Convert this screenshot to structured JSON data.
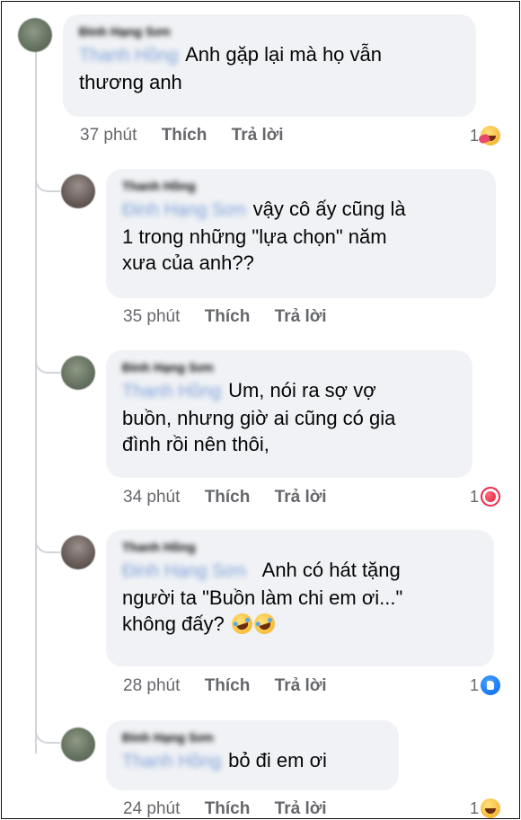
{
  "comments": [
    {
      "author": "Đinh Hạng Sơn",
      "mention": "Thanh Hồng",
      "text_lines": [
        "Anh gặp lại mà họ vẫn",
        "thương anh"
      ],
      "time": "37 phút",
      "like_label": "Thích",
      "reply_label": "Trả lời",
      "reaction_count": "1",
      "reaction_icon": "care-icon"
    },
    {
      "author": "Thanh Hồng",
      "mention": "Đinh Hạng Sơn",
      "text_lines": [
        "vậy cô ấy cũng là",
        "1 trong những \"lựa chọn\" năm",
        "xưa của anh??"
      ],
      "time": "35 phút",
      "like_label": "Thích",
      "reply_label": "Trả lời"
    },
    {
      "author": "Đinh Hạng Sơn",
      "mention": "Thanh Hồng",
      "text_lines": [
        "Um, nói ra sợ vợ",
        "buồn, nhưng giờ ai cũng có gia",
        "đình rồi nên thôi,"
      ],
      "time": "34 phút",
      "like_label": "Thích",
      "reply_label": "Trả lời",
      "reaction_count": "1",
      "reaction_icon": "love-icon"
    },
    {
      "author": "Thanh Hồng",
      "mention": "Đinh Hạng Sơn",
      "text_lines": [
        "Anh có hát tặng",
        "người ta \"Buồn làm chi em ơi...\"",
        "không đấy?"
      ],
      "time": "28 phút",
      "like_label": "Thích",
      "reply_label": "Trả lời",
      "reaction_count": "1",
      "reaction_icon": "like-icon"
    },
    {
      "author": "Đinh Hạng Sơn",
      "mention": "Thanh Hồng",
      "text_lines": [
        "bỏ đi em ơi"
      ],
      "time": "24 phút",
      "like_label": "Thích",
      "reply_label": "Trả lời",
      "reaction_count": "1",
      "reaction_icon": "haha-icon"
    }
  ],
  "colors": {
    "bubble": "#f0f2f5",
    "meta_text": "#65676b",
    "mention": "#7d9fd8"
  }
}
